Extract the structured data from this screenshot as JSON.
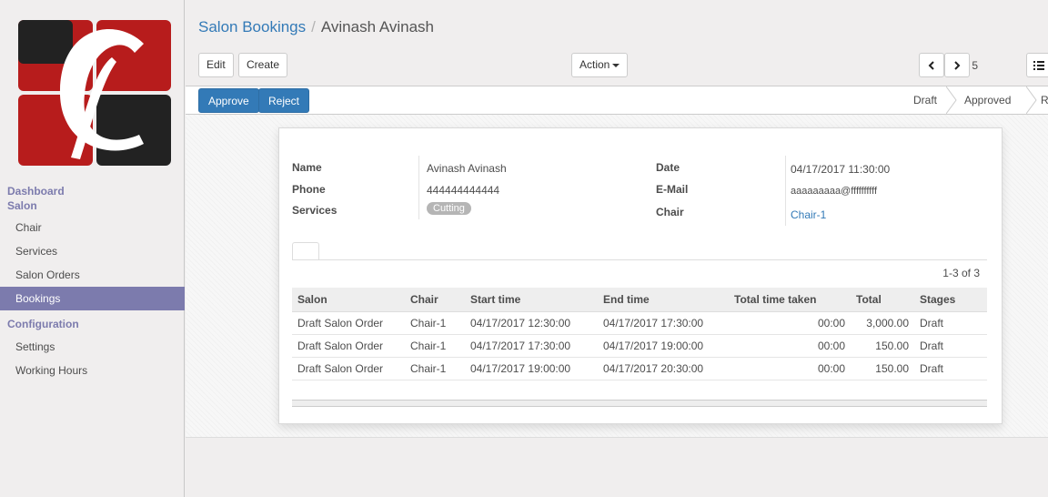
{
  "sidebar": {
    "sections": [
      {
        "label": "Dashboard"
      },
      {
        "label": "Salon"
      },
      {
        "label": "Configuration"
      }
    ],
    "items": [
      {
        "label": "Chair"
      },
      {
        "label": "Services"
      },
      {
        "label": "Salon Orders"
      },
      {
        "label": "Bookings"
      },
      {
        "label": "Settings"
      },
      {
        "label": "Working Hours"
      }
    ]
  },
  "breadcrumb": {
    "parent": "Salon Bookings",
    "separator": "/",
    "current": "Avinash Avinash"
  },
  "toolbar": {
    "edit_label": "Edit",
    "create_label": "Create",
    "action_label": "Action"
  },
  "pager": {
    "value": "5 / 5"
  },
  "statusbar": {
    "approve_label": "Approve",
    "reject_label": "Reject",
    "stages": [
      "Draft",
      "Approved",
      "R"
    ]
  },
  "form": {
    "name_label": "Name",
    "name_value": "Avinash Avinash",
    "phone_label": "Phone",
    "phone_value": "444444444444",
    "services_label": "Services",
    "services_tag": "Cutting",
    "date_label": "Date",
    "date_value": "04/17/2017 11:30:00",
    "email_label": "E-Mail",
    "email_value": "aaaaaaaaa@ffffffffff",
    "chair_label": "Chair",
    "chair_value": "Chair-1"
  },
  "lines": {
    "record_count": "1-3 of 3",
    "headers": [
      "Salon",
      "Chair",
      "Start time",
      "End time",
      "Total time taken",
      "Total",
      "Stages"
    ],
    "rows": [
      [
        "Draft Salon Order",
        "Chair-1",
        "04/17/2017 12:30:00",
        "04/17/2017 17:30:00",
        "00:00",
        "3,000.00",
        "Draft"
      ],
      [
        "Draft Salon Order",
        "Chair-1",
        "04/17/2017 17:30:00",
        "04/17/2017 19:00:00",
        "00:00",
        "150.00",
        "Draft"
      ],
      [
        "Draft Salon Order",
        "Chair-1",
        "04/17/2017 19:00:00",
        "04/17/2017 20:30:00",
        "00:00",
        "150.00",
        "Draft"
      ]
    ]
  },
  "colors": {
    "accent": "#7c7bad",
    "primary": "#337ab7",
    "logo_red": "#b71c1c",
    "logo_dark": "#222222"
  }
}
